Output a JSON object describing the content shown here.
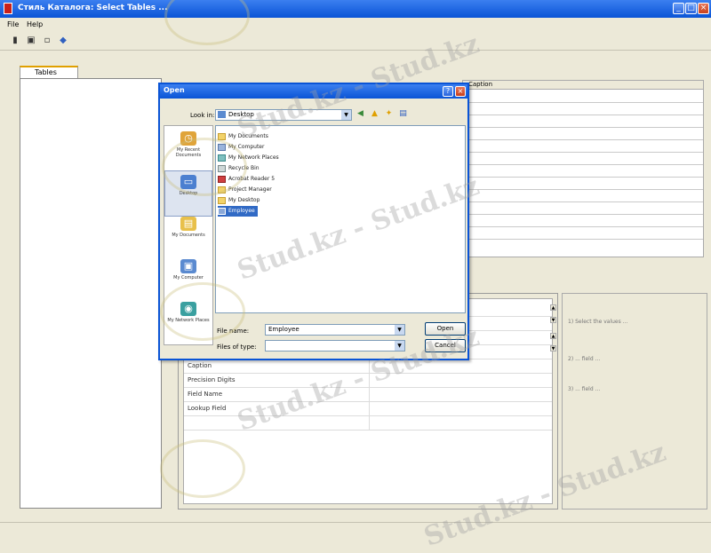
{
  "window": {
    "title": "Стиль Каталога: Select Tables ..."
  },
  "menubar": {
    "items": [
      "File",
      "Help"
    ]
  },
  "toolbar": {
    "icons": [
      "new-icon",
      "open-icon",
      "save-icon",
      "help-icon"
    ]
  },
  "left_panel": {
    "tab_label": "Tables"
  },
  "grid_top": {
    "header_label": "Caption"
  },
  "properties": {
    "rows": [
      "",
      "",
      "",
      "",
      "Caption",
      "Precision Digits",
      "Field Name",
      "Lookup Field",
      ""
    ]
  },
  "help_panel": {
    "texts": [
      "1) Select the values ...",
      "2) ... field ...",
      "3) ... field ..."
    ]
  },
  "dialog": {
    "title": "Open",
    "look_in_label": "Look in:",
    "look_in_value": "Desktop",
    "places": [
      {
        "label": "My Recent Documents",
        "icon": "recent-documents-icon",
        "color": "#e0a43a"
      },
      {
        "label": "Desktop",
        "icon": "desktop-icon",
        "color": "#4b7fd0",
        "selected": true
      },
      {
        "label": "My Documents",
        "icon": "my-documents-icon",
        "color": "#e8c04a"
      },
      {
        "label": "My Computer",
        "icon": "my-computer-icon",
        "color": "#5a8ad0"
      },
      {
        "label": "My Network Places",
        "icon": "my-network-icon",
        "color": "#3aa0a0"
      }
    ],
    "files": [
      {
        "name": "My Documents"
      },
      {
        "name": "My Computer"
      },
      {
        "name": "My Network Places"
      },
      {
        "name": "Recycle Bin"
      },
      {
        "name": "Acrobat Reader 5"
      },
      {
        "name": "Project Manager"
      },
      {
        "name": "My Desktop"
      },
      {
        "name": "Employee",
        "selected": true
      }
    ],
    "file_name_label": "File name:",
    "file_name_value": "Employee",
    "files_of_type_label": "Files of type:",
    "files_of_type_value": "",
    "open_label": "Open",
    "cancel_label": "Cancel"
  },
  "watermark": {
    "text": "Stud.kz - Stud.kz"
  }
}
